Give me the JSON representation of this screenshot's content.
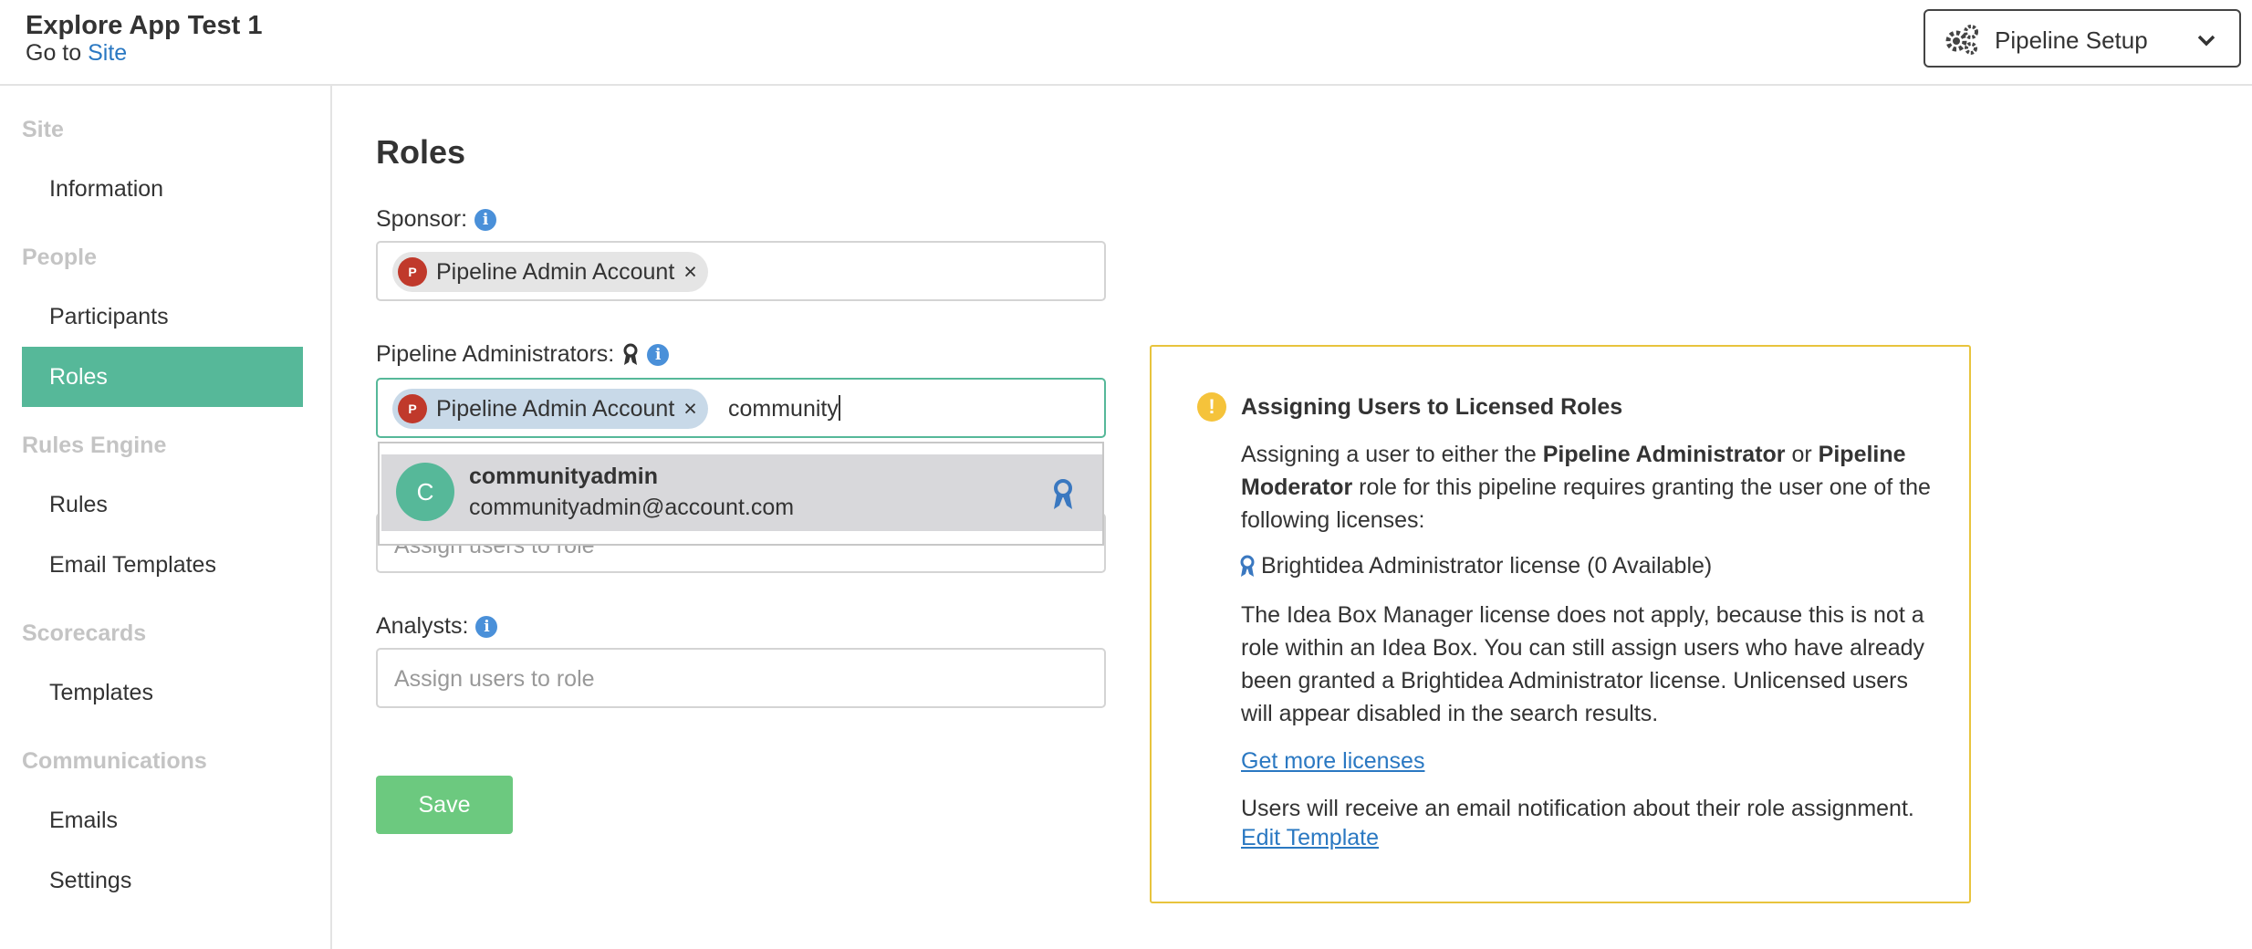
{
  "header": {
    "app_title": "Explore App Test 1",
    "goto_prefix": "Go to",
    "goto_link": "Site",
    "pipeline_button": "Pipeline Setup"
  },
  "sidebar": {
    "sections": [
      {
        "title": "Site",
        "items": [
          "Information"
        ]
      },
      {
        "title": "People",
        "items": [
          "Participants",
          "Roles"
        ]
      },
      {
        "title": "Rules Engine",
        "items": [
          "Rules",
          "Email Templates"
        ]
      },
      {
        "title": "Scorecards",
        "items": [
          "Templates"
        ]
      },
      {
        "title": "Communications",
        "items": [
          "Emails",
          "Settings"
        ]
      }
    ],
    "active_item": "Roles"
  },
  "main": {
    "title": "Roles",
    "sponsor": {
      "label": "Sponsor:",
      "chip": {
        "initial": "P",
        "name": "Pipeline Admin Account",
        "remove": "×"
      }
    },
    "pipeline_admins": {
      "label": "Pipeline Administrators:",
      "chip": {
        "initial": "P",
        "name": "Pipeline Admin Account",
        "remove": "×"
      },
      "typed_value": "community",
      "hidden_placeholder": "Assign users to role"
    },
    "dropdown": {
      "initial": "C",
      "name": "communityadmin",
      "email": "communityadmin@account.com"
    },
    "analysts": {
      "label": "Analysts:",
      "placeholder": "Assign users to role"
    },
    "save_label": "Save"
  },
  "panel": {
    "title": "Assigning Users to Licensed Roles",
    "p1_a": "Assigning a user to either the ",
    "p1_b": "Pipeline Administrator",
    "p1_c": " or ",
    "p1_d": "Pipeline Moderator",
    "p1_e": " role for this pipeline requires granting the user one of the following licenses:",
    "license": "Brightidea Administrator license (0 Available)",
    "p2": "The Idea Box Manager license does not apply, because this is not a role within an Idea Box. You can still assign users who have already been granted a Brightidea Administrator license. Unlicensed users will appear disabled in the search results.",
    "link1": "Get more licenses",
    "p3": "Users will receive an email notification about their role assignment.",
    "link2": "Edit Template"
  },
  "colors": {
    "accent": "#56b899",
    "link": "#2a78c2",
    "panel_border": "#e8c43d",
    "save": "#6cc97f",
    "avatar_red": "#c0392b"
  }
}
